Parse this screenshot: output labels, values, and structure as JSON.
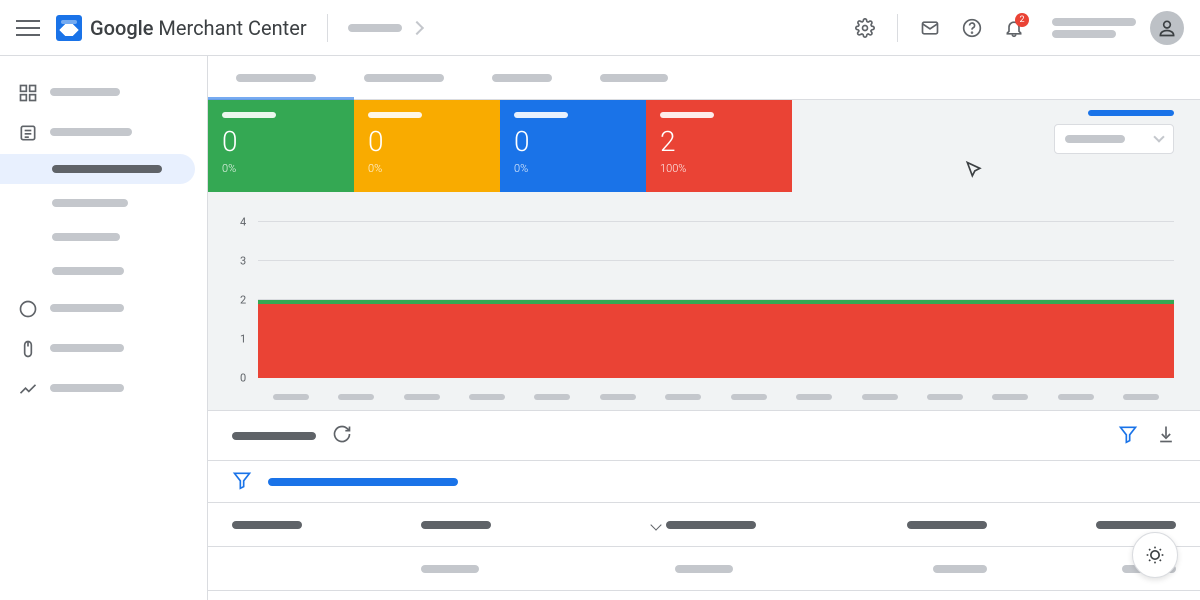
{
  "app": {
    "name_bold": "Google",
    "name_rest": " Merchant Center"
  },
  "header": {
    "notification_count": "2"
  },
  "cards": [
    {
      "color": "green",
      "value": "0",
      "pct": "0%"
    },
    {
      "color": "yellow",
      "value": "0",
      "pct": "0%"
    },
    {
      "color": "blue",
      "value": "0",
      "pct": "0%"
    },
    {
      "color": "red",
      "value": "2",
      "pct": "100%"
    }
  ],
  "chart_data": {
    "type": "area",
    "ylim": [
      0,
      4
    ],
    "y_ticks": [
      "0",
      "1",
      "2",
      "3",
      "4"
    ],
    "x_tick_count": 14,
    "series": [
      {
        "name": "red-series",
        "color": "#ea4335",
        "constant_value": 2
      },
      {
        "name": "green-series",
        "color": "#34a853",
        "constant_value": 2
      }
    ],
    "note": "All x positions show a flat value of 2; red fills 0–2, green line sits at 2."
  }
}
